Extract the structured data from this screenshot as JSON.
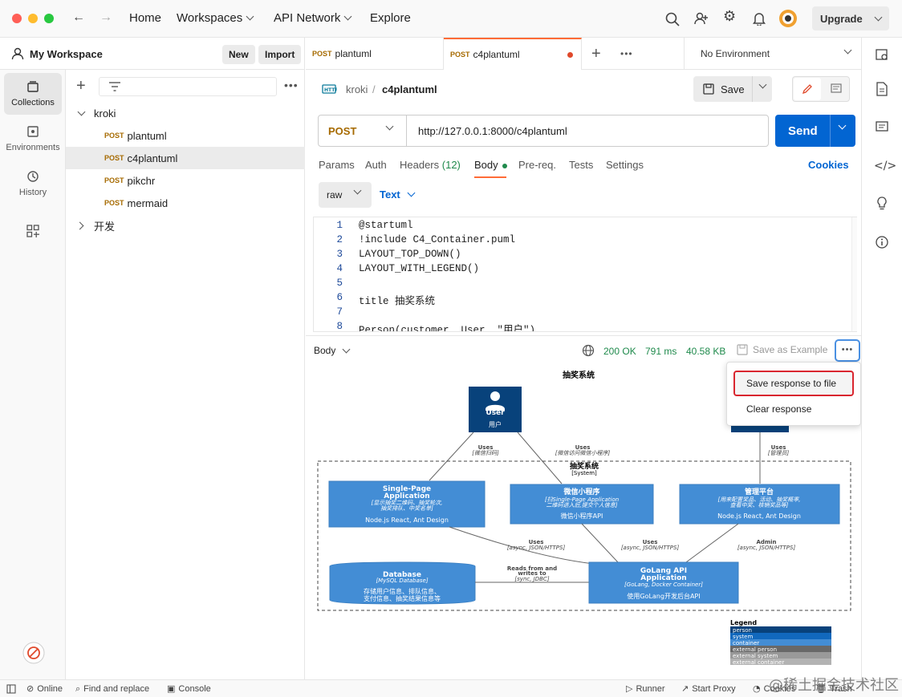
{
  "topbar": {
    "home": "Home",
    "workspaces": "Workspaces",
    "api_network": "API Network",
    "explore": "Explore",
    "upgrade": "Upgrade"
  },
  "sidebar": {
    "workspace": "My Workspace",
    "new": "New",
    "import": "Import",
    "rail": [
      {
        "label": "Collections"
      },
      {
        "label": "Environments"
      },
      {
        "label": "History"
      }
    ],
    "tree": {
      "root": "kroki",
      "items": [
        {
          "method": "POST",
          "name": "plantuml"
        },
        {
          "method": "POST",
          "name": "c4plantuml"
        },
        {
          "method": "POST",
          "name": "pikchr"
        },
        {
          "method": "POST",
          "name": "mermaid"
        }
      ],
      "folder2": "开发"
    }
  },
  "tabs": [
    {
      "method": "POST",
      "name": "plantuml"
    },
    {
      "method": "POST",
      "name": "c4plantuml"
    }
  ],
  "environment": "No Environment",
  "request": {
    "breadcrumb_root": "kroki",
    "breadcrumb_sep": "/",
    "name": "c4plantuml",
    "save": "Save",
    "method": "POST",
    "url": "http://127.0.0.1:8000/c4plantuml",
    "send": "Send"
  },
  "subtabs": {
    "params": "Params",
    "auth": "Auth",
    "headers": "Headers",
    "headers_count": "(12)",
    "body": "Body",
    "prereq": "Pre-req.",
    "tests": "Tests",
    "settings": "Settings",
    "cookies": "Cookies"
  },
  "body_mode": {
    "raw": "raw",
    "text": "Text"
  },
  "code_lines": [
    {
      "n": "1",
      "t": "@startuml"
    },
    {
      "n": "2",
      "t": "!include C4_Container.puml"
    },
    {
      "n": "3",
      "t": "LAYOUT_TOP_DOWN()"
    },
    {
      "n": "4",
      "t": "LAYOUT_WITH_LEGEND()"
    },
    {
      "n": "5",
      "t": ""
    },
    {
      "n": "6",
      "t": "title 抽奖系统"
    },
    {
      "n": "7",
      "t": ""
    },
    {
      "n": "8",
      "t": "Person(customer, User, \"用户\")"
    }
  ],
  "response": {
    "label": "Body",
    "status": "200 OK",
    "time": "791 ms",
    "size": "40.58 KB",
    "save_example": "Save as Example"
  },
  "menu": {
    "save_file": "Save response to file",
    "clear": "Clear response"
  },
  "diagram": {
    "title": "抽奖系统",
    "user_label": "User",
    "user_desc": "用户",
    "rel1": "Uses",
    "rel1_tech": "[微信扫码]",
    "rel2": "Uses",
    "rel2_tech": "[微信访问微信小程序]",
    "rel3": "Uses",
    "rel3_tech": "[管理员]",
    "boundary": "抽奖系统",
    "boundary_type": "[System]",
    "spa_title": "Single-Page",
    "spa_title2": "Application",
    "spa_desc": "[显示抽奖二维码、抽奖轮次,",
    "spa_desc2": "抽奖排队、中奖名单]",
    "spa_tech": "Node.js React, Ant Design",
    "wx_title": "微信小程序",
    "wx_desc": "[扫Single-Page Application",
    "wx_desc2": "二维码进入后,提交个人信息]",
    "wx_tech": "微信小程序API",
    "admin_title": "管理平台",
    "admin_desc": "[用来配置奖品、活动、抽奖概率,",
    "admin_desc2": "查看中奖、核销奖品等]",
    "admin_tech": "Node.js React, Ant Design",
    "r4": "Uses",
    "r4_tech": "[async, JSON/HTTPS]",
    "r5": "Uses",
    "r5_tech": "[async, JSON/HTTPS]",
    "r6": "Admin",
    "r6_tech": "[async, JSON/HTTPS]",
    "db_title": "Database",
    "db_type": "[MySQL Database]",
    "db_desc": "存储用户信息、排队信息、",
    "db_desc2": "支付信息、抽奖结果信息等",
    "r7": "Reads from and",
    "r7b": "writes to",
    "r7_tech": "[sync, JDBC]",
    "api_title": "GoLang API",
    "api_title2": "Application",
    "api_type": "[GoLang, Docker Container]",
    "api_desc": "使用GoLang开发后台API",
    "legend": "Legend",
    "legend_items": [
      "person",
      "system",
      "container",
      "external person",
      "external system",
      "external container"
    ]
  },
  "statusbar": {
    "online": "Online",
    "find": "Find and replace",
    "console": "Console",
    "runner": "Runner",
    "proxy": "Start Proxy",
    "cookies": "Cookies",
    "trash": "Trash"
  },
  "watermark": "@稀土掘金技术社区"
}
